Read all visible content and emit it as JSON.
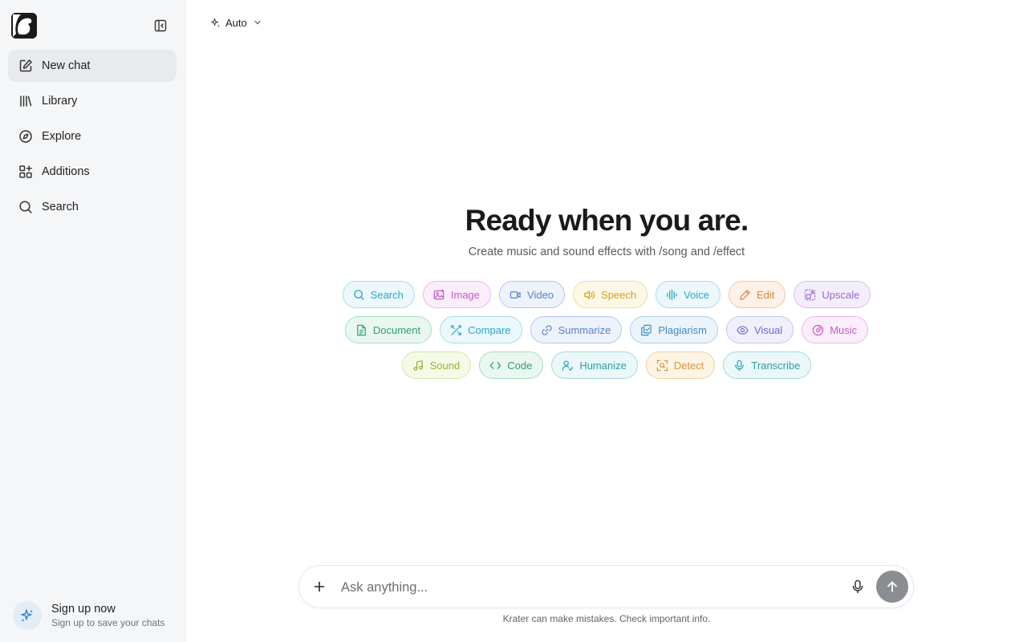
{
  "sidebar": {
    "items": [
      {
        "label": "New chat",
        "icon": "edit-icon"
      },
      {
        "label": "Library",
        "icon": "library-icon"
      },
      {
        "label": "Explore",
        "icon": "compass-icon"
      },
      {
        "label": "Additions",
        "icon": "grid-plus-icon"
      },
      {
        "label": "Search",
        "icon": "search-icon"
      }
    ],
    "signup_title": "Sign up now",
    "signup_subtitle": "Sign up to save your chats"
  },
  "model_selector": {
    "label": "Auto"
  },
  "hero": {
    "title": "Ready when you are.",
    "subtitle": "Create music and sound effects with /song and /effect"
  },
  "chips": [
    [
      {
        "label": "Search",
        "color": "#29a8c9",
        "bg": "#ecf8fc",
        "border": "#a6dcec",
        "icon": "search-icon"
      },
      {
        "label": "Image",
        "color": "#c85ac8",
        "bg": "#fbeefb",
        "border": "#ecb6ec",
        "icon": "image-icon"
      },
      {
        "label": "Video",
        "color": "#5a80c8",
        "bg": "#eef2fb",
        "border": "#b3c6ea",
        "icon": "video-icon"
      },
      {
        "label": "Speech",
        "color": "#d4a21a",
        "bg": "#fdf8e6",
        "border": "#f0dc9c",
        "icon": "speaker-icon"
      },
      {
        "label": "Voice",
        "color": "#29a8c9",
        "bg": "#ecf8fc",
        "border": "#a6dcec",
        "icon": "waveform-icon"
      },
      {
        "label": "Edit",
        "color": "#e0843a",
        "bg": "#fdf1e8",
        "border": "#f2c7a4",
        "icon": "pencil-icon"
      },
      {
        "label": "Upscale",
        "color": "#9a6ad0",
        "bg": "#f4eefc",
        "border": "#d3bdef",
        "icon": "upscale-icon"
      }
    ],
    [
      {
        "label": "Document",
        "color": "#2f9e72",
        "bg": "#eaf7f1",
        "border": "#a8dcc6",
        "icon": "document-icon"
      },
      {
        "label": "Compare",
        "color": "#29a8c9",
        "bg": "#ecf8fc",
        "border": "#a6dcec",
        "icon": "compare-icon"
      },
      {
        "label": "Summarize",
        "color": "#5a80c8",
        "bg": "#eef2fb",
        "border": "#b3c6ea",
        "icon": "link-icon"
      },
      {
        "label": "Plagiarism",
        "color": "#3f8ac0",
        "bg": "#ecf4fb",
        "border": "#acccea",
        "icon": "copy-check-icon"
      },
      {
        "label": "Visual",
        "color": "#6a6ad0",
        "bg": "#f0f0fc",
        "border": "#c4c4ef",
        "icon": "eye-icon"
      },
      {
        "label": "Music",
        "color": "#c85ac8",
        "bg": "#fbeefb",
        "border": "#ecb6ec",
        "icon": "disc-icon"
      }
    ],
    [
      {
        "label": "Sound",
        "color": "#8ab82a",
        "bg": "#f5fae8",
        "border": "#d3e7a4",
        "icon": "music-note-icon"
      },
      {
        "label": "Code",
        "color": "#2f9e72",
        "bg": "#eaf7f1",
        "border": "#a8dcc6",
        "icon": "code-icon"
      },
      {
        "label": "Humanize",
        "color": "#29a0a8",
        "bg": "#ebf7f8",
        "border": "#a6d9dc",
        "icon": "user-check-icon"
      },
      {
        "label": "Detect",
        "color": "#e0943a",
        "bg": "#fdf4e6",
        "border": "#f2d09c",
        "icon": "scan-icon"
      },
      {
        "label": "Transcribe",
        "color": "#29a0a8",
        "bg": "#ebf7f8",
        "border": "#a6d9dc",
        "icon": "microphone-icon"
      }
    ]
  ],
  "composer": {
    "placeholder": "Ask anything..."
  },
  "disclaimer": "Krater can make mistakes. Check important info."
}
